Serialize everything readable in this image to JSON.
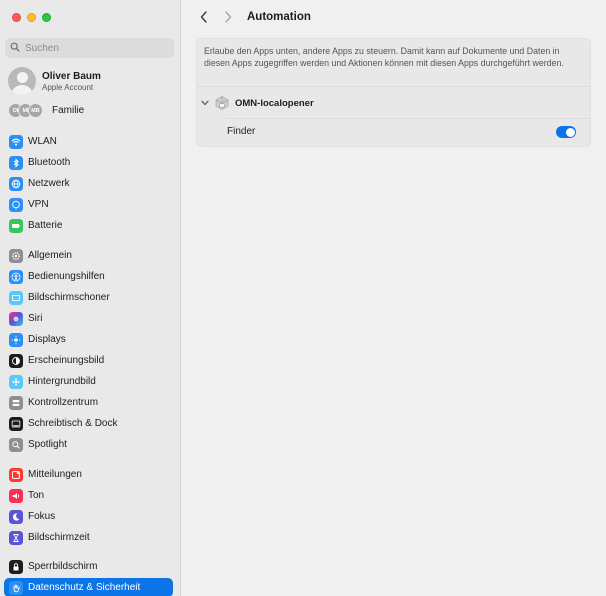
{
  "window": {
    "title": "Automation"
  },
  "sidebar": {
    "search_placeholder": "Suchen",
    "account": {
      "name": "Oliver Baum",
      "subtitle": "Apple Account"
    },
    "family": {
      "label": "Familie",
      "avatars": [
        "OI",
        "MI",
        "MB"
      ]
    },
    "items": [
      {
        "label": "WLAN",
        "icon": "wifi-icon",
        "color": "#2c8ff5"
      },
      {
        "label": "Bluetooth",
        "icon": "bluetooth-icon",
        "color": "#2c8ff5"
      },
      {
        "label": "Netzwerk",
        "icon": "globe-icon",
        "color": "#2c8ff5"
      },
      {
        "label": "VPN",
        "icon": "vpn-globe-icon",
        "color": "#2c8ff5"
      },
      {
        "label": "Batterie",
        "icon": "battery-icon",
        "color": "#34c759"
      },
      {
        "label": "Allgemein",
        "icon": "gear-icon",
        "color": "#8e8e93"
      },
      {
        "label": "Bedienungshilfen",
        "icon": "accessibility-icon",
        "color": "#2c8ff5"
      },
      {
        "label": "Bildschirmschoner",
        "icon": "screensaver-icon",
        "color": "#5ac8fa"
      },
      {
        "label": "Siri",
        "icon": "siri-icon",
        "color": "#222222"
      },
      {
        "label": "Displays",
        "icon": "sun-icon",
        "color": "#2c8ff5"
      },
      {
        "label": "Erscheinungsbild",
        "icon": "appearance-icon",
        "color": "#1d1d1f"
      },
      {
        "label": "Hintergrundbild",
        "icon": "flower-icon",
        "color": "#5ac8fa"
      },
      {
        "label": "Kontrollzentrum",
        "icon": "sliders-icon",
        "color": "#8e8e93"
      },
      {
        "label": "Schreibtisch & Dock",
        "icon": "dock-icon",
        "color": "#1d1d1f"
      },
      {
        "label": "Spotlight",
        "icon": "magnifier-icon",
        "color": "#8e8e93"
      },
      {
        "label": "Mitteilungen",
        "icon": "bell-icon",
        "color": "#ff3b30"
      },
      {
        "label": "Ton",
        "icon": "speaker-icon",
        "color": "#ff2d55"
      },
      {
        "label": "Fokus",
        "icon": "moon-icon",
        "color": "#5856d6"
      },
      {
        "label": "Bildschirmzeit",
        "icon": "hourglass-icon",
        "color": "#5856d6"
      },
      {
        "label": "Sperrbildschirm",
        "icon": "lock-icon",
        "color": "#1d1d1f"
      },
      {
        "label": "Datenschutz & Sicherheit",
        "icon": "hand-icon",
        "color": "#2c8ff5",
        "selected": true
      }
    ]
  },
  "main": {
    "title": "Automation",
    "description": "Erlaube den Apps unten, andere Apps zu steuern. Damit kann auf Dokumente und Daten in diesen Apps zugegriffen werden und Aktionen können mit diesen Apps durchgeführt werden.",
    "app": {
      "name": "OMN-localopener",
      "icon": "app-generic-icon"
    },
    "permissions": [
      {
        "label": "Finder",
        "enabled": true
      }
    ]
  },
  "colors": {
    "accent": "#0a74e8"
  }
}
